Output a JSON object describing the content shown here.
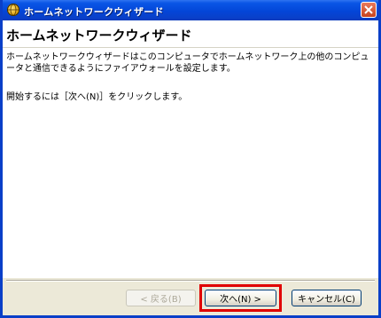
{
  "window": {
    "title": "ホームネットワークウィザード",
    "icon": "network-globe-icon",
    "close_icon": "close-icon"
  },
  "page": {
    "heading": "ホームネットワークウィザード",
    "description": "ホームネットワークウィザードはこのコンピュータでホームネットワーク上の他のコンピュータと通信できるようにファイアウォールを設定します。",
    "instruction": "開始するには［次へ(N)］をクリックします。"
  },
  "buttons": {
    "back": "< 戻る(B)",
    "next": "次へ(N) >",
    "cancel": "キャンセル(C)"
  },
  "colors": {
    "titlebar": "#0a56e6",
    "highlight": "#e00000",
    "dialog_bg": "#ece9d8"
  }
}
